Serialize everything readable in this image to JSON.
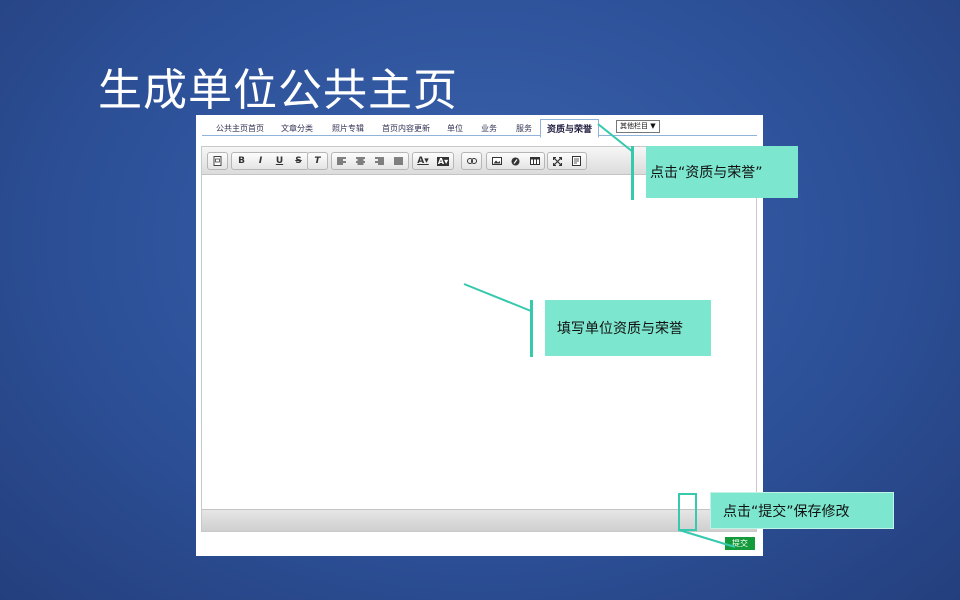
{
  "slide_title": "生成单位公共主页",
  "tabs": [
    {
      "label": "公共主页首页"
    },
    {
      "label": "文章分类"
    },
    {
      "label": "照片专辑"
    },
    {
      "label": "首页内容更新"
    },
    {
      "label": "单位"
    },
    {
      "label": "业务"
    },
    {
      "label": "服务"
    },
    {
      "label": "资质与荣誉",
      "active": true
    }
  ],
  "tab_select": "其他栏目 ▼",
  "toolbar": {
    "groups": [
      [
        "source-icon"
      ],
      [
        "B",
        "I",
        "U",
        "S"
      ],
      [
        "T"
      ],
      [
        "align-left-icon",
        "align-center-icon",
        "align-right-icon",
        "align-justify-icon"
      ],
      [
        "A▾",
        "A▾"
      ],
      [
        "link-icon"
      ],
      [
        "image-icon",
        "flash-icon",
        "table-icon"
      ],
      [
        "maximize-icon",
        "preview-icon"
      ]
    ]
  },
  "submit_label": "提交",
  "callouts": {
    "click_tab": "点击“资质与荣誉”",
    "fill_content": "填写单位资质与荣誉",
    "click_submit": "点击“提交”保存修改"
  },
  "colors": {
    "background": "#2d5199",
    "callout": "#7de6cf",
    "callout_bar": "#36c9ad",
    "submit": "#139a3a"
  }
}
